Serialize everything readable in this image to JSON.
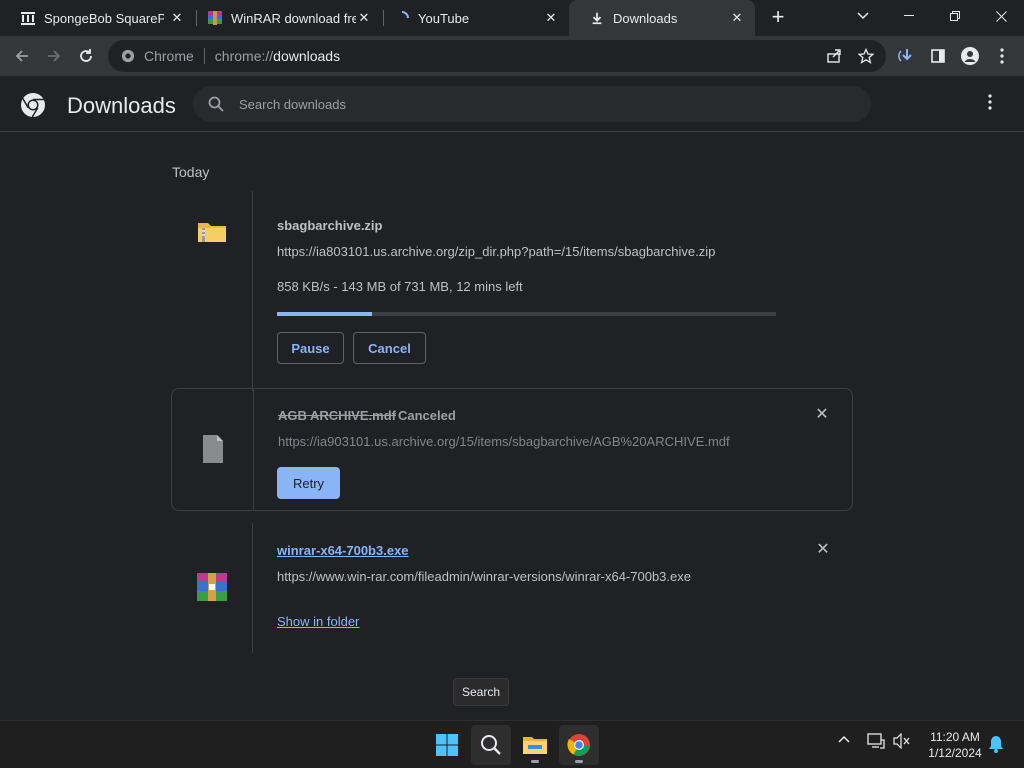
{
  "tabs": [
    {
      "title": "SpongeBob SquarePants",
      "favicon": "archive-icon"
    },
    {
      "title": "WinRAR download free",
      "favicon": "winrar-icon"
    },
    {
      "title": "YouTube",
      "favicon": "loading-spinner-icon"
    },
    {
      "title": "Downloads",
      "favicon": "download-icon",
      "active": true
    }
  ],
  "address": {
    "site_label": "Chrome",
    "scheme": "chrome://",
    "host": "downloads"
  },
  "page": {
    "title": "Downloads",
    "search_placeholder": "Search downloads",
    "section": "Today"
  },
  "downloads": [
    {
      "name": "sbagbarchive.zip",
      "url": "https://ia803101.us.archive.org/zip_dir.php?path=/15/items/sbagbarchive.zip",
      "status": "858 KB/s - 143 MB of 731 MB, 12 mins left",
      "progress": 0.19,
      "actions": [
        "Pause",
        "Cancel"
      ]
    },
    {
      "name": "AGB ARCHIVE.mdf",
      "state": "Canceled",
      "url": "https://ia903101.us.archive.org/15/items/sbagbarchive/AGB%20ARCHIVE.mdf",
      "actions": [
        "Retry"
      ]
    },
    {
      "name": "winrar-x64-700b3.exe",
      "url": "https://www.win-rar.com/fileadmin/winrar-versions/winrar-x64-700b3.exe",
      "actions": [
        "Show in folder"
      ]
    }
  ],
  "tooltip": "Search",
  "taskbar": {
    "time": "11:20 AM",
    "date": "1/12/2024"
  },
  "colors": {
    "accent": "#8ab4f8",
    "bg": "#202124",
    "toolbar": "#35363a"
  }
}
